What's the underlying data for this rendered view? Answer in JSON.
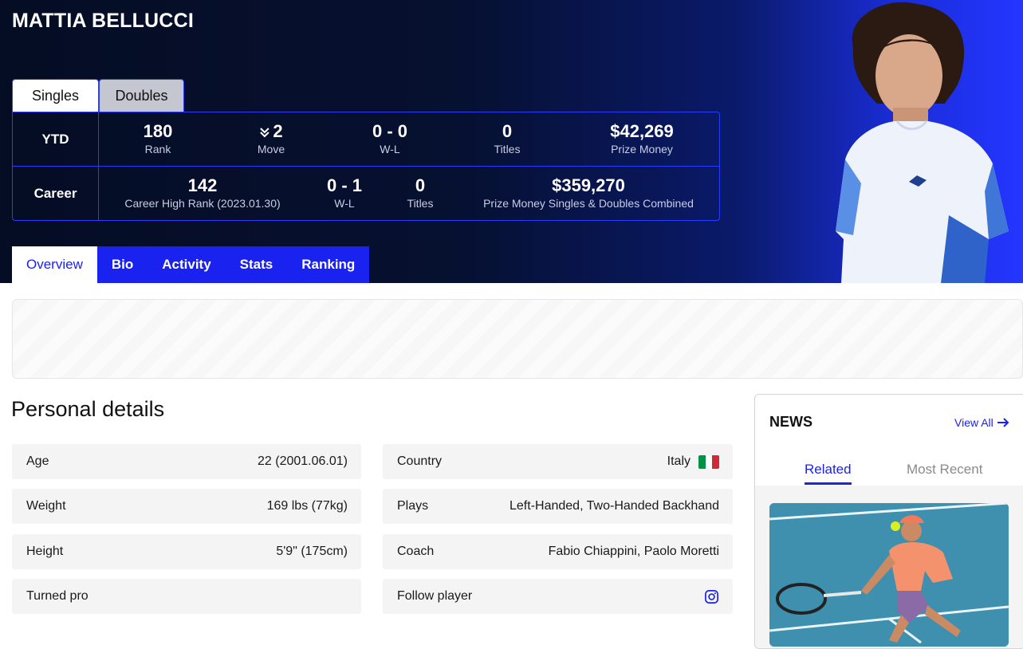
{
  "player": {
    "name": "MATTIA BELLUCCI"
  },
  "type_tabs": [
    {
      "label": "Singles",
      "active": true
    },
    {
      "label": "Doubles",
      "active": false
    }
  ],
  "ytd": {
    "label": "YTD",
    "rank": {
      "value": "180",
      "label": "Rank"
    },
    "move": {
      "value": "2",
      "label": "Move",
      "direction": "down"
    },
    "wl": {
      "value": "0 - 0",
      "label": "W-L"
    },
    "titles": {
      "value": "0",
      "label": "Titles"
    },
    "prize": {
      "value": "$42,269",
      "label": "Prize Money"
    }
  },
  "career": {
    "label": "Career",
    "high_rank": {
      "value": "142",
      "label": "Career High Rank (2023.01.30)"
    },
    "wl": {
      "value": "0 - 1",
      "label": "W-L"
    },
    "titles": {
      "value": "0",
      "label": "Titles"
    },
    "prize": {
      "value": "$359,270",
      "label": "Prize Money Singles & Doubles Combined"
    }
  },
  "nav": [
    {
      "label": "Overview",
      "active": true
    },
    {
      "label": "Bio",
      "active": false
    },
    {
      "label": "Activity",
      "active": false
    },
    {
      "label": "Stats",
      "active": false
    },
    {
      "label": "Ranking",
      "active": false
    }
  ],
  "personal": {
    "title": "Personal details",
    "age": {
      "key": "Age",
      "value": "22 (2001.06.01)"
    },
    "weight": {
      "key": "Weight",
      "value": "169 lbs (77kg)"
    },
    "height": {
      "key": "Height",
      "value": "5'9\" (175cm)"
    },
    "turned_pro": {
      "key": "Turned pro",
      "value": ""
    },
    "country": {
      "key": "Country",
      "value": "Italy",
      "flag_colors": [
        "#009246",
        "#ffffff",
        "#ce2b37"
      ]
    },
    "plays": {
      "key": "Plays",
      "value": "Left-Handed, Two-Handed Backhand"
    },
    "coach": {
      "key": "Coach",
      "value": "Fabio Chiappini, Paolo Moretti"
    },
    "follow": {
      "key": "Follow player",
      "icon": "instagram-icon"
    }
  },
  "news": {
    "title": "NEWS",
    "view_all": "View All",
    "tabs": [
      {
        "label": "Related",
        "active": true
      },
      {
        "label": "Most Recent",
        "active": false
      }
    ]
  },
  "colors": {
    "accent": "#1a22f0",
    "hero_dark": "#050d24",
    "hero_blue": "#2436ff"
  }
}
